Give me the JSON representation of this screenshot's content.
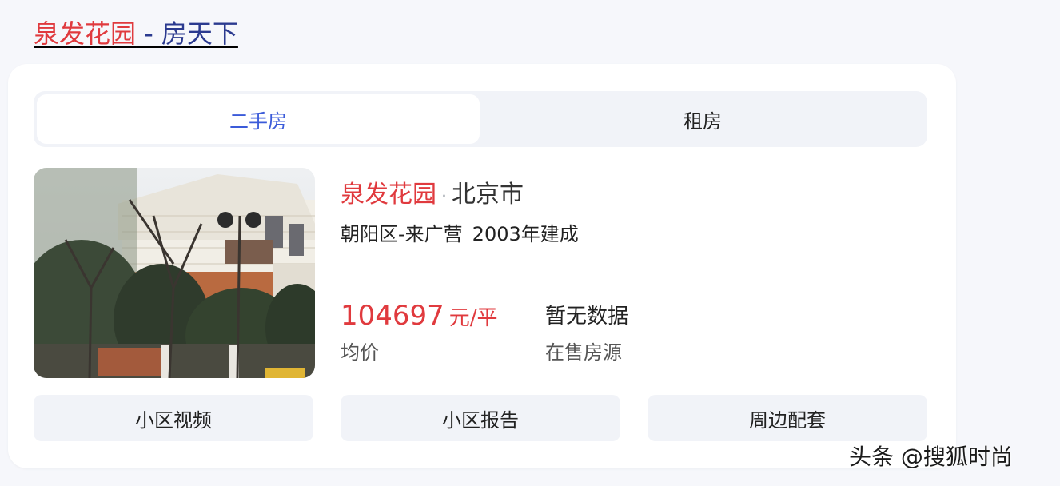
{
  "header": {
    "title_highlight": "泉发花园",
    "title_rest": " - 房天下"
  },
  "tabs": [
    {
      "label": "二手房",
      "active": true
    },
    {
      "label": "租房",
      "active": false
    }
  ],
  "community": {
    "name": "泉发花园",
    "separator": "·",
    "city": "北京市",
    "district": "朝阳区-来广营",
    "built": "2003年建成"
  },
  "stats": {
    "price_value": "104697",
    "price_unit": "元/平",
    "price_label": "均价",
    "sale_value": "暂无数据",
    "sale_label": "在售房源"
  },
  "actions": [
    {
      "label": "小区视频"
    },
    {
      "label": "小区报告"
    },
    {
      "label": "周边配套"
    }
  ],
  "watermark": "头条 @搜狐时尚",
  "colors": {
    "accent_red": "#e03a3e",
    "link_blue": "#2b3a8f",
    "tab_active_blue": "#3b5bd9"
  }
}
